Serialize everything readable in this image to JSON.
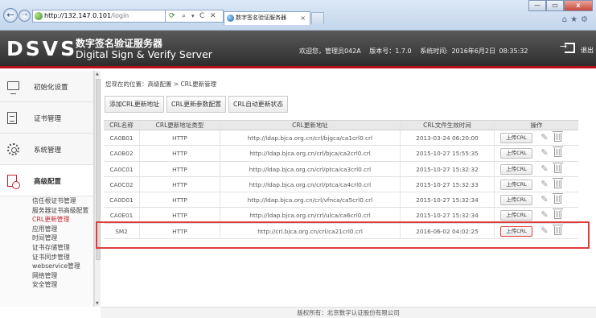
{
  "browser": {
    "address_host": "http://132.147.0.101",
    "address_path": "/login",
    "tab_title": "数字签名验证服务器",
    "tab_close": "×",
    "win_minimize": "—",
    "win_restore": "▭",
    "win_close": "x",
    "toolbar_glyphs": "⌂★⚙",
    "nav_back": "←",
    "nav_forward": "→"
  },
  "header": {
    "logo_main": "DSVS",
    "logo_cn": "数字签名验证服务器",
    "logo_en": "Digital Sign & Verify Server",
    "welcome": "欢迎您，管理员042A",
    "version": "版本号：1.7.0",
    "time": "系统时间: 2016年6月2日 08:35:32",
    "logout_label": "退出"
  },
  "sidebar": {
    "items": [
      {
        "label": "初始化设置",
        "icon": "monitor-icon"
      },
      {
        "label": "证书管理",
        "icon": "document-icon"
      },
      {
        "label": "系统管理",
        "icon": "gear-icon"
      },
      {
        "label": "高级配置",
        "icon": "advanced-config-icon"
      }
    ],
    "sub_items": [
      "信任根证书管理",
      "服务器证书高级配置",
      "CRL更新管理",
      "应用管理",
      "时间管理",
      "证书存储管理",
      "证书同步管理",
      "webservice管理",
      "网络管理",
      "安全管理"
    ],
    "active_sub_index": 2
  },
  "main": {
    "breadcrumb": "您现在的位置：高级配置 > CRL更新管理",
    "buttons": [
      "添加CRL更新地址",
      "CRL更新参数配置",
      "CRL自动更新状态"
    ],
    "columns": [
      "CRL名称",
      "CRL更新地址类型",
      "CRL更新地址",
      "CRL文件生效时间",
      "操作"
    ],
    "upload_label": "上传CRL",
    "rows": [
      {
        "name": "CA0B01",
        "type": "HTTP",
        "url": "http://ldap.bjca.org.cn/crl/bjgca/ca1crl0.crl",
        "time": "2013-03-24 06:20:00"
      },
      {
        "name": "CA0B02",
        "type": "HTTP",
        "url": "http://ldap.bjca.org.cn/crl/bjca/ca2crl0.crl",
        "time": "2015-10-27 15:55:35"
      },
      {
        "name": "CA0C01",
        "type": "HTTP",
        "url": "http://ldap.bjca.org.cn/crl/ptca/ca3crl0.crl",
        "time": "2015-10-27 15:32:32"
      },
      {
        "name": "CA0C02",
        "type": "HTTP",
        "url": "http://ldap.bjca.org.cn/crl/ptca/ca4crl0.crl",
        "time": "2015-10-27 15:32:33"
      },
      {
        "name": "CA0D01",
        "type": "HTTP",
        "url": "http://ldap.bjca.org.cn/crl/vfnca/ca5crl0.crl",
        "time": "2015-10-27 15:32:34"
      },
      {
        "name": "CA0E01",
        "type": "HTTP",
        "url": "http://ldap.bjca.org.cn/crl/ulca/ca6crl0.crl",
        "time": "2015-10-27 15:32:34"
      },
      {
        "name": "SM2",
        "type": "HTTP",
        "url": "http://crl.bjca.org.cn/crl/ca21crl0.crl",
        "time": "2016-06-02 04:02:25"
      }
    ],
    "highlighted_row_index": 6
  },
  "footer": {
    "text": "版权所有：北京数字认证股份有限公司"
  },
  "colors": {
    "accent_red": "#b90f1c",
    "highlight_red": "#e23b3b",
    "active_link": "#c0262f",
    "header_bg": "#3a3a3a"
  }
}
